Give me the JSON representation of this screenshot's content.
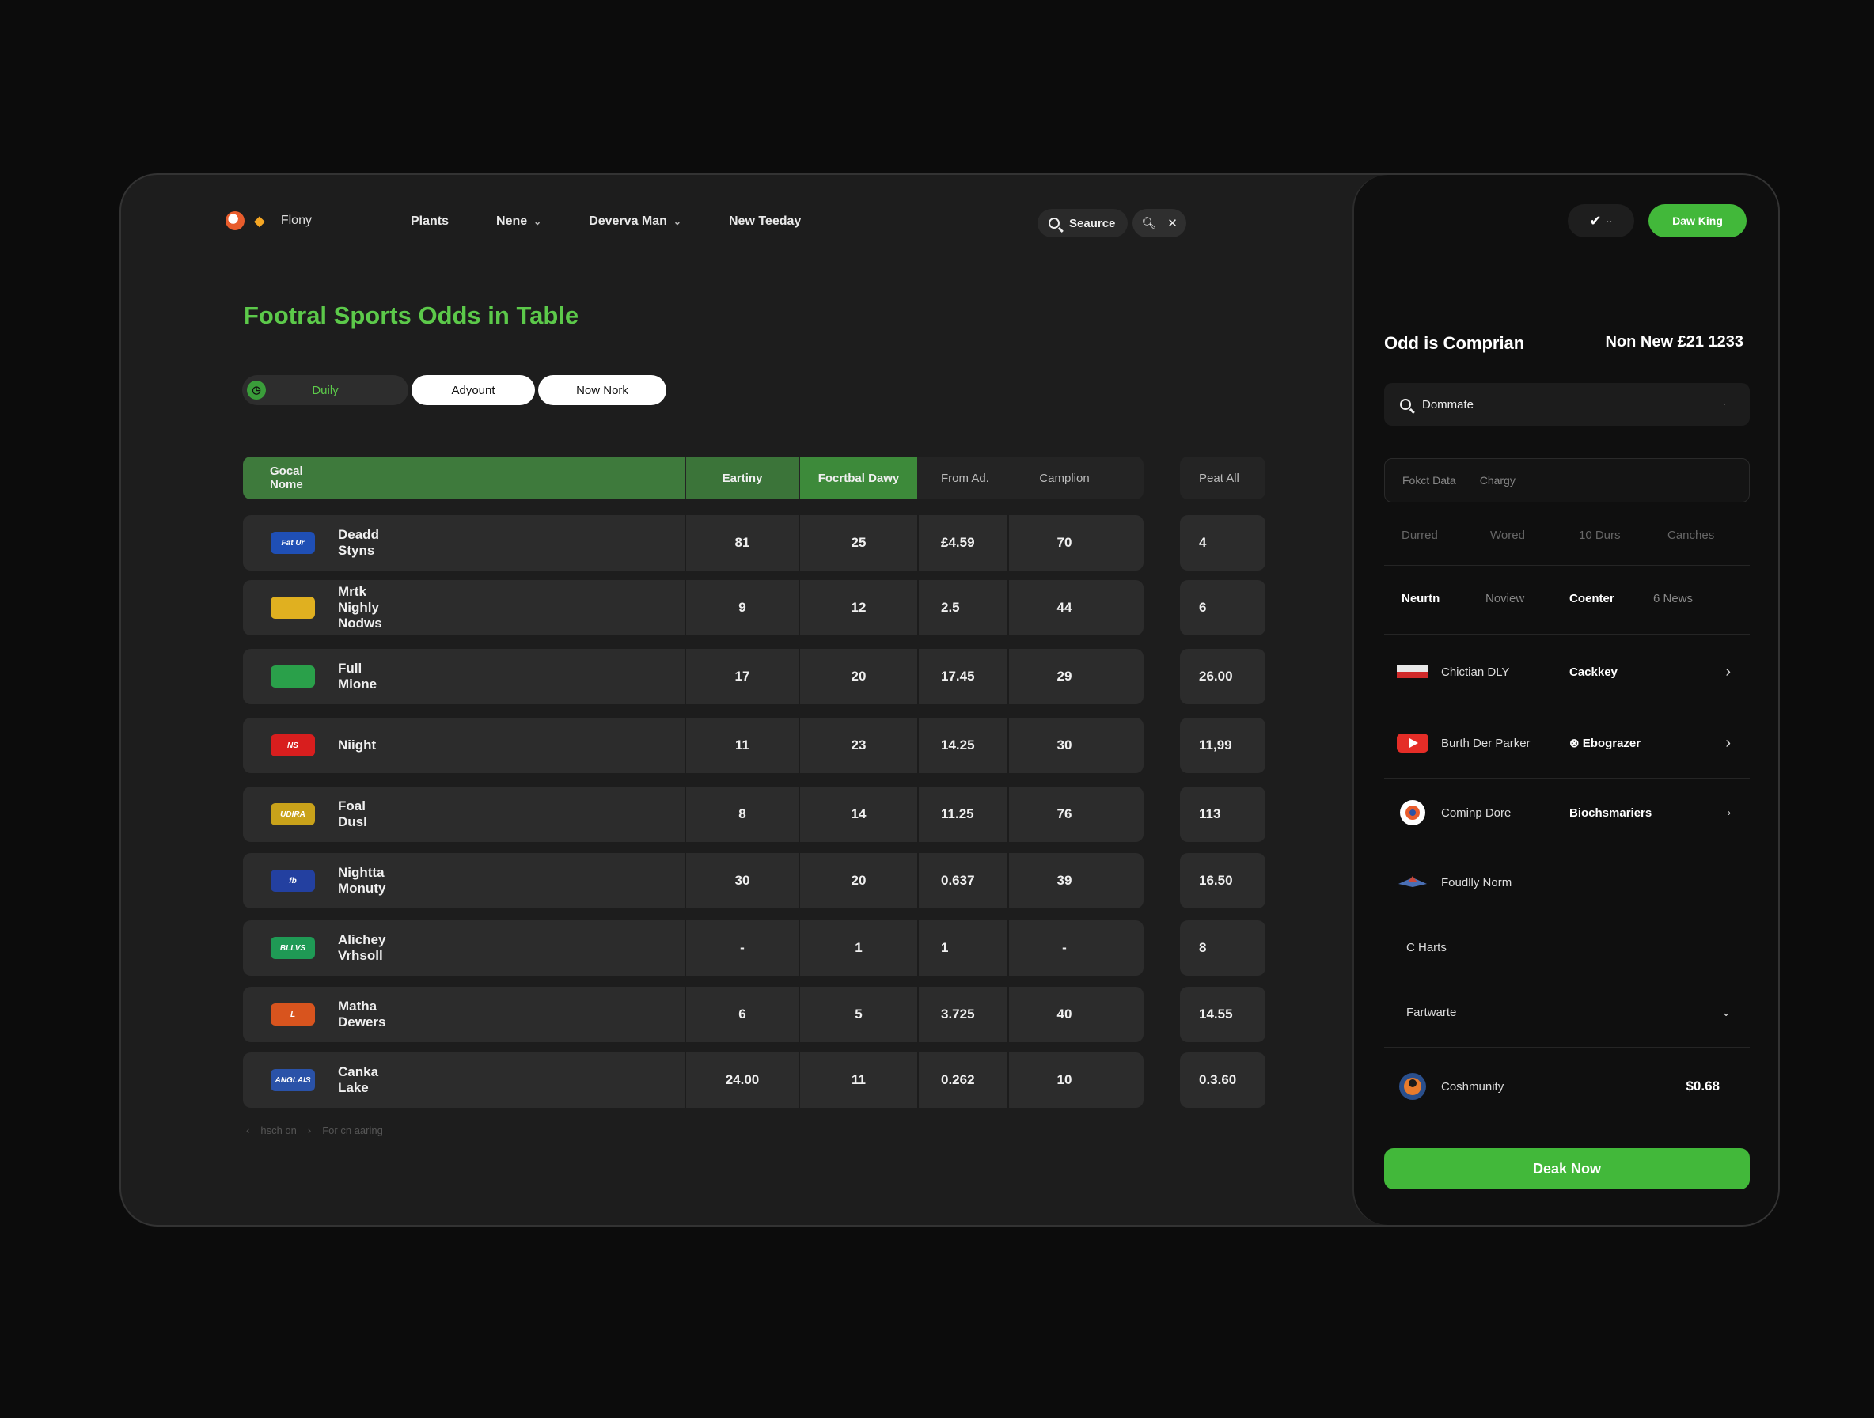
{
  "nav": {
    "brand": "Flony",
    "items": [
      "Plants",
      "Nene",
      "Deverva Man",
      "New Teeday"
    ],
    "search_label": "Seaurce"
  },
  "page": {
    "title": "Footral Sports Odds in Table"
  },
  "filters": [
    "Duily",
    "Adyount",
    "Now Nork"
  ],
  "table": {
    "headers": [
      "Gocal Nome",
      "Eartiny",
      "Focrtbal Dawy",
      "From Ad.",
      "Camplion",
      "Peat All"
    ],
    "rows": [
      {
        "team": "Deadd Styns",
        "a": "81",
        "b": "25",
        "c": "£4.59",
        "d": "70",
        "e": "4",
        "logo_text": "Fat Ur",
        "logo_color": "#1f4fb5"
      },
      {
        "team": "Mrtk Nighly Nodws",
        "a": "9",
        "b": "12",
        "c": "2.5",
        "d": "44",
        "e": "6",
        "logo_text": "",
        "logo_color": "#e0b020"
      },
      {
        "team": "Full Mione",
        "a": "17",
        "b": "20",
        "c": "17.45",
        "d": "29",
        "e": "26.00",
        "logo_text": "",
        "logo_color": "#2aa04a"
      },
      {
        "team": "Niight",
        "a": "11",
        "b": "23",
        "c": "14.25",
        "d": "30",
        "e": "11,99",
        "logo_text": "NS",
        "logo_color": "#d81e1e"
      },
      {
        "team": "Foal Dusl",
        "a": "8",
        "b": "14",
        "c": "11.25",
        "d": "76",
        "e": "113",
        "logo_text": "UDIRA",
        "logo_color": "#c9a21a"
      },
      {
        "team": "Nightta Monuty",
        "a": "30",
        "b": "20",
        "c": "0.637",
        "d": "39",
        "e": "16.50",
        "logo_text": "fb",
        "logo_color": "#2340a0"
      },
      {
        "team": "Alichey Vrhsoll",
        "a": "-",
        "b": "1",
        "c": "1",
        "d": "-",
        "e": "8",
        "logo_text": "BLLVS",
        "logo_color": "#1f9a55"
      },
      {
        "team": "Matha Dewers",
        "a": "6",
        "b": "5",
        "c": "3.725",
        "d": "40",
        "e": "14.55",
        "logo_text": "L",
        "logo_color": "#d8541e"
      },
      {
        "team": "Canka Lake",
        "a": "24.00",
        "b": "11",
        "c": "0.262",
        "d": "10",
        "e": "0.3.60",
        "logo_text": "ANGLAIS",
        "logo_color": "#2a52a8"
      }
    ]
  },
  "pager": [
    "hsch on",
    "For cn aaring"
  ],
  "right": {
    "cta_top": "Daw King",
    "title": "Odd is Comprian",
    "total": "Non New £21 1233",
    "search_value": "Dommate",
    "tabs": [
      "Fokct Data",
      "Chargy"
    ],
    "sub_tabs": [
      "Durred",
      "Wored",
      "10 Durs",
      "Canches"
    ],
    "sub_tabs2": [
      "Neurtn",
      "Noview",
      "Coenter",
      "6 News"
    ],
    "items": [
      {
        "name": "Chictian DLY",
        "value": "Cackkey",
        "arrow": "›"
      },
      {
        "name": "Burth Der Parker",
        "value": "Ebograzer",
        "value_icon": "⊗",
        "arrow": "›"
      },
      {
        "name": "Cominp Dore",
        "value": "Biochsmariers",
        "arrow": "›"
      },
      {
        "name": "Foudlly Norm",
        "value": "",
        "arrow": ""
      },
      {
        "name": "C Harts",
        "value": "",
        "arrow": ""
      },
      {
        "name": "Fartwarte",
        "value": "",
        "arrow": "⌄"
      }
    ],
    "community": {
      "name": "Coshmunity",
      "amount": "$0.68"
    },
    "cta_bottom": "Deak Now"
  }
}
